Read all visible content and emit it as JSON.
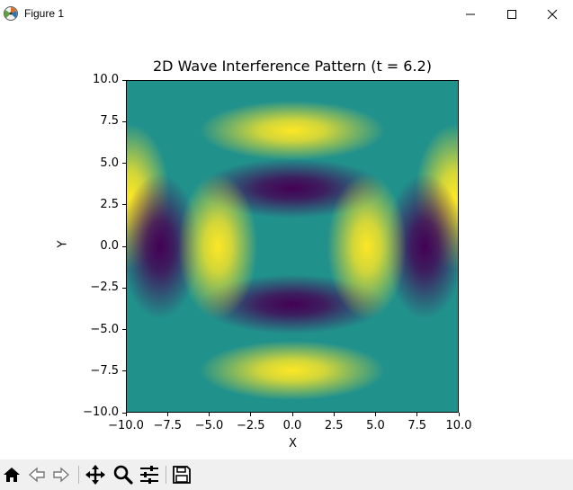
{
  "window": {
    "title": "Figure 1"
  },
  "toolbar": {
    "icons": [
      "home-icon",
      "back-icon",
      "forward-icon",
      "pan-icon",
      "zoom-icon",
      "configure-subplots-icon",
      "save-icon"
    ]
  },
  "colors": {
    "colormap": "viridis",
    "toolbar_bg": "#f0f0f0"
  },
  "chart_data": {
    "type": "heatmap",
    "title": "2D Wave Interference Pattern (t = 6.2)",
    "xlabel": "X",
    "ylabel": "Y",
    "xlim": [
      -10.0,
      10.0
    ],
    "ylim": [
      -10.0,
      10.0
    ],
    "xticks": [
      "−10.0",
      "−7.5",
      "−5.0",
      "−2.5",
      "0.0",
      "2.5",
      "5.0",
      "7.5",
      "10.0"
    ],
    "yticks": [
      "10.0",
      "7.5",
      "5.0",
      "2.5",
      "0.0",
      "−2.5",
      "−5.0",
      "−7.5",
      "−10.0"
    ],
    "colormap": "viridis",
    "grid": false,
    "features": [
      {
        "type": "max",
        "x": 0.0,
        "y": 7.0
      },
      {
        "type": "max",
        "x": 0.0,
        "y": -7.5
      },
      {
        "type": "max",
        "x": -4.5,
        "y": 0.0
      },
      {
        "type": "max",
        "x": 4.5,
        "y": 0.0
      },
      {
        "type": "min",
        "x": 0.0,
        "y": 3.5
      },
      {
        "type": "min",
        "x": 0.0,
        "y": -3.5
      },
      {
        "type": "min",
        "x": -8.0,
        "y": 0.0
      },
      {
        "type": "min",
        "x": 8.0,
        "y": 0.0
      },
      {
        "type": "max",
        "x": -9.8,
        "y": 3.0
      },
      {
        "type": "max",
        "x": 9.8,
        "y": 3.0
      }
    ]
  }
}
